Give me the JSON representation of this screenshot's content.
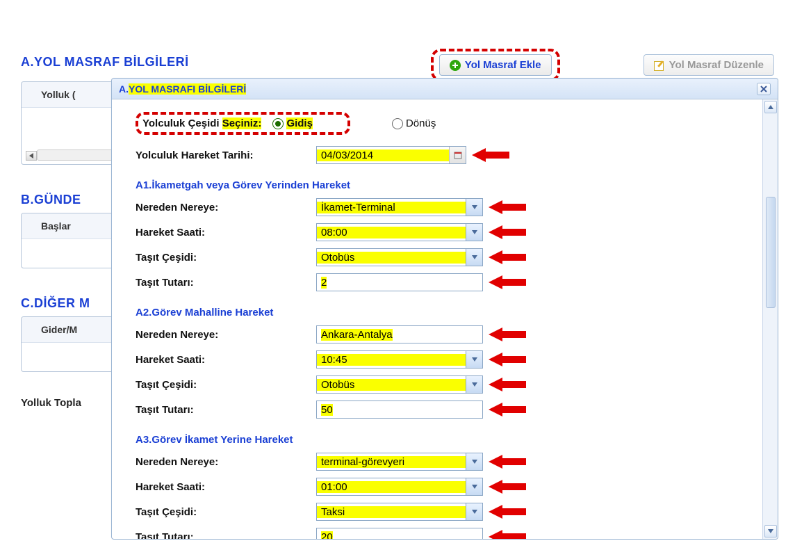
{
  "headers": {
    "a": "A.YOL MASRAF BİLGİLERİ",
    "b": "B.GÜNDE",
    "c": "C.DİĞER M"
  },
  "top_buttons": {
    "add": "Yol Masraf Ekle",
    "edit": "Yol Masraf Düzenle"
  },
  "bg_labels": {
    "yolluk_col": "Yolluk (",
    "baslar": "Başlar",
    "gider": "Gider/M",
    "toplam": "Yolluk Topla"
  },
  "modal": {
    "title_prefix": "A.",
    "title_hl": "YOL MASRAFI BİLGİLERİ",
    "radio_label_prefix": "Yolculuk Çeşidi ",
    "radio_label_hl": "Seçiniz:",
    "radio_gidis": "Gidiş",
    "radio_donus": "Dönüş",
    "hareket_tarihi_label": "Yolculuk Hareket Tarihi:",
    "hareket_tarihi_value": "04/03/2014",
    "a1_head": "A1.İkametgah veya Görev Yerinden Hareket",
    "a2_head": "A2.Görev Mahalline Hareket",
    "a3_head": "A3.Görev İkamet Yerine Hareket",
    "labels": {
      "nereden": "Nereden Nereye:",
      "saat": "Hareket Saati:",
      "tasit": "Taşıt Çeşidi:",
      "tutar": "Taşıt Tutarı:"
    },
    "a1": {
      "nereden": "İkamet-Terminal",
      "saat": "08:00",
      "tasit": "Otobüs",
      "tutar": "2"
    },
    "a2": {
      "nereden": "Ankara-Antalya",
      "saat": "10:45",
      "tasit": "Otobüs",
      "tutar": "50"
    },
    "a3": {
      "nereden": "terminal-görevyeri",
      "saat": "01:00",
      "tasit": "Taksi",
      "tutar": "20"
    }
  }
}
